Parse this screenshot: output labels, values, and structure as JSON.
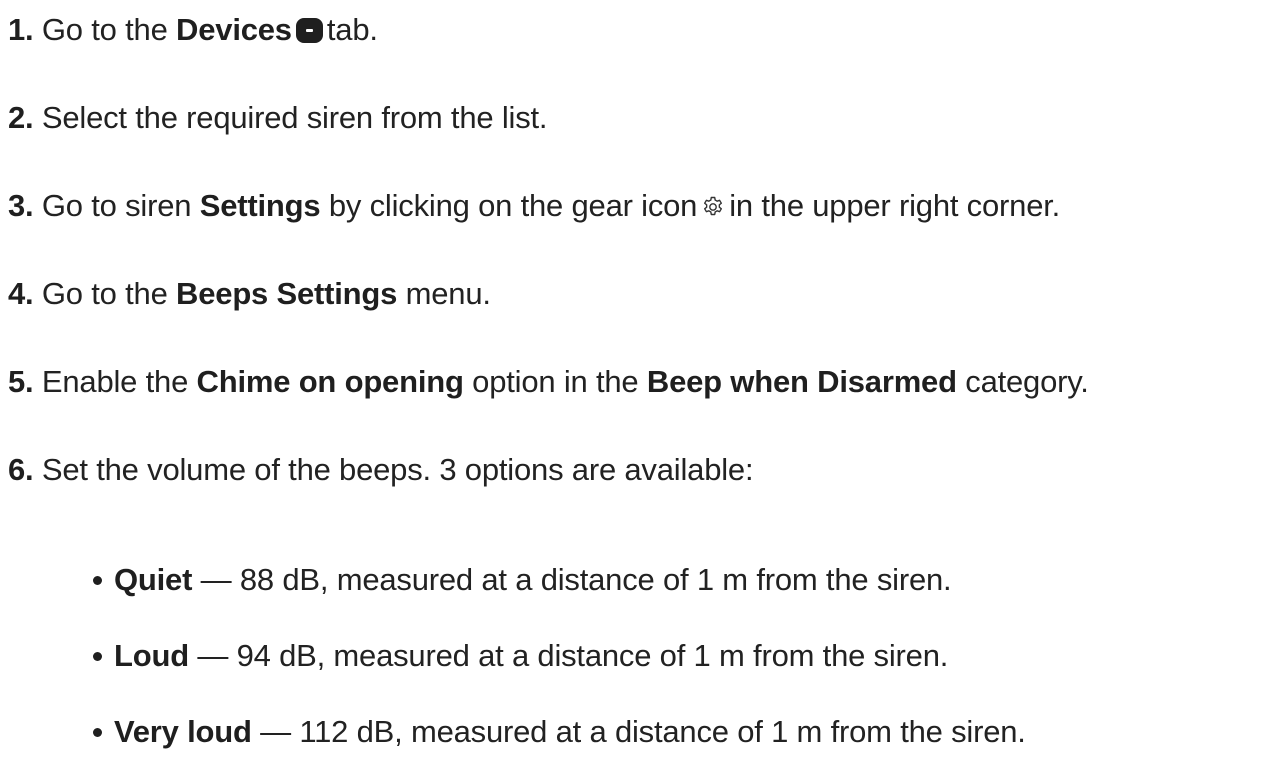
{
  "steps": [
    {
      "num": "1.",
      "pre": "Go to the",
      "bold": "Devices",
      "post": "tab.",
      "icon": "devices-icon"
    },
    {
      "num": "2.",
      "text": "Select the required siren from the list."
    },
    {
      "num": "3.",
      "pre": "Go to siren",
      "bold": "Settings",
      "mid": "by clicking on the gear icon",
      "post": "in the upper right corner.",
      "icon": "gear-icon"
    },
    {
      "num": "4.",
      "pre": "Go to the",
      "bold": "Beeps Settings",
      "post": "menu."
    },
    {
      "num": "5.",
      "pre": "Enable the",
      "bold": "Chime on opening",
      "mid": "option in the",
      "bold2": "Beep when Disarmed",
      "post": "category."
    },
    {
      "num": "6.",
      "text": "Set the volume of the beeps. 3 options are available:"
    }
  ],
  "volume_options": [
    {
      "label": "Quiet",
      "text": "— 88 dB, measured at a distance of 1 m from the siren."
    },
    {
      "label": "Loud",
      "text": "— 94 dB, measured at a distance of 1 m from the siren."
    },
    {
      "label": "Very loud",
      "text": "— 112 dB, measured at a distance of 1 m from the siren."
    }
  ]
}
